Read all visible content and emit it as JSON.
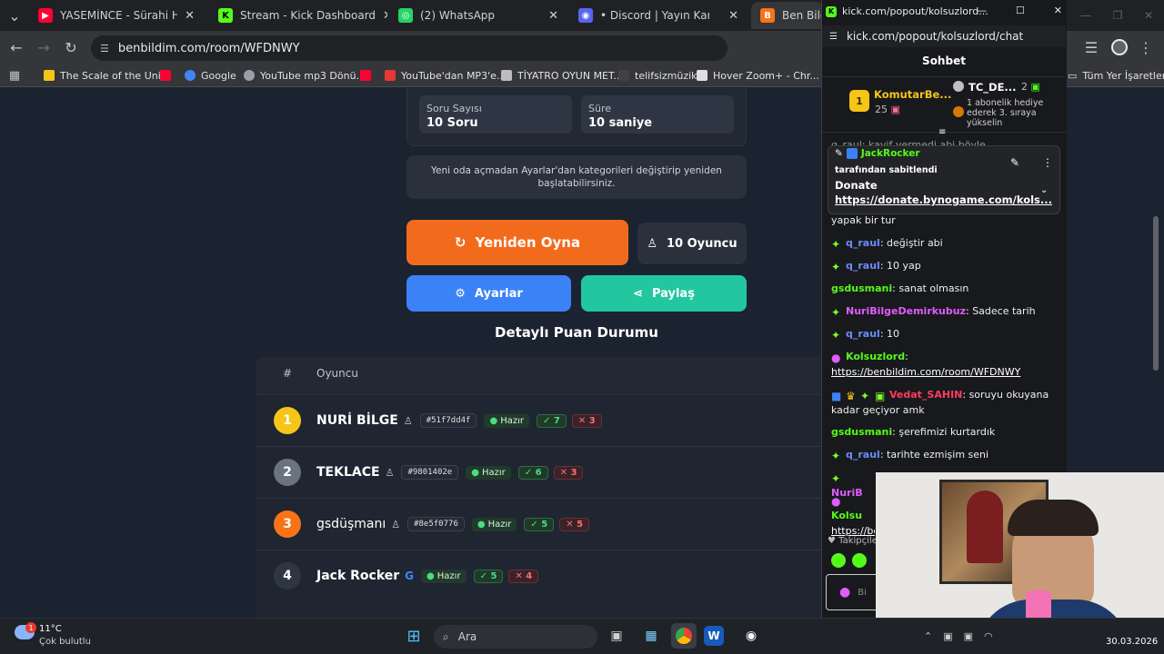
{
  "tabs": [
    {
      "label": "YASEMİNCE - Sürahi Hanım - Te",
      "color": "#ff0033",
      "glyph": "▶"
    },
    {
      "label": "Stream - Kick Dashboard",
      "color": "#53fc18",
      "glyph": "K"
    },
    {
      "label": "(2) WhatsApp",
      "color": "#25d366",
      "glyph": "◎"
    },
    {
      "label": "• Discord | Yayın Kanalı | Ko",
      "color": "#5865f2",
      "glyph": "◉"
    },
    {
      "label": "Ben Bildim",
      "color": "#f97316",
      "glyph": "B"
    }
  ],
  "address": "benbildim.com/room/WFDNWY",
  "bookmarks": [
    {
      "label": "The Scale of the Uni...",
      "color": "#f5c518"
    },
    {
      "label": "",
      "color": "#ff0033"
    },
    {
      "label": "Google",
      "color": "#4285f4"
    },
    {
      "label": "YouTube mp3 Dönü...",
      "color": "#9aa0a6"
    },
    {
      "label": "",
      "color": "#ff0033"
    },
    {
      "label": "YouTube'dan MP3'e...",
      "color": "#e53935"
    },
    {
      "label": "TİYATRO OYUN MET...",
      "color": "#bdbdbd"
    },
    {
      "label": "telifsizmüzik",
      "color": "#424242"
    },
    {
      "label": "Hover Zoom+ - Chr...",
      "color": "#e0e0e0"
    }
  ],
  "bookmarks_right": "Tüm Yer İşaretleri",
  "room": {
    "soru_label": "Soru Sayısı",
    "soru_value": "10 Soru",
    "sure_label": "Süre",
    "sure_value": "10 saniye",
    "notice": "Yeni oda açmadan Ayarlar'dan kategorileri değiştirip yeniden başlatabilirsiniz.",
    "replay": "Yeniden Oyna",
    "players": "10 Oyuncu",
    "settings": "Ayarlar",
    "share": "Paylaş",
    "scoreboard_title": "Detaylı Puan Durumu",
    "col_rank": "#",
    "col_player": "Oyuncu"
  },
  "players": [
    {
      "rank": "1",
      "name": "NURİ BİLGE",
      "id": "#51f7dd4f",
      "status": "Hazır",
      "correct": "7",
      "wrong": "3",
      "color": "#f5c518"
    },
    {
      "rank": "2",
      "name": "TEKLACE",
      "id": "#9801402e",
      "status": "Hazır",
      "correct": "6",
      "wrong": "3",
      "color": "#9aa0a6"
    },
    {
      "rank": "3",
      "name": "gsdüşmanı",
      "id": "#8e5f0776",
      "status": "Hazır",
      "correct": "5",
      "wrong": "5",
      "color": "#f97316"
    },
    {
      "rank": "4",
      "name": "Jack Rocker",
      "id": "",
      "status": "Hazır",
      "correct": "5",
      "wrong": "4",
      "color": "#2f3643"
    }
  ],
  "popup": {
    "url_title": "kick.com/popout/kolsuzlord...",
    "url": "kick.com/popout/kolsuzlord/chat",
    "header": "Sohbet",
    "lb1_name": "KomutarBe...",
    "lb1_count": "25",
    "lb2_name": "TC_DE...",
    "lb2_count": "2",
    "lb_note": "1 abonelik hediye ederek 3. sıraya yükselin",
    "pin_user": "JackRocker",
    "pin_by": "tarafından sabitlendi",
    "pin_title": "Donate",
    "pin_link": "https://donate.bynogame.com/kols...",
    "overflow": "yapak bir tur",
    "follow": "Takipçile",
    "input_placeholder": "Bi"
  },
  "chat": [
    {
      "user": "q_raul",
      "text": "değiştir abi",
      "cls": "ub",
      "badge": "✦"
    },
    {
      "user": "q_raul",
      "text": "10 yap",
      "cls": "ub",
      "badge": "✦"
    },
    {
      "user": "gsdusmani",
      "text": "sanat olmasın",
      "cls": "ug",
      "badge": ""
    },
    {
      "user": "NuriBilgeDemirkubuz",
      "text": "Sadece tarih",
      "cls": "up",
      "badge": "✦"
    },
    {
      "user": "q_raul",
      "text": "10",
      "cls": "ub",
      "badge": "✦"
    },
    {
      "user": "Kolsuzlord",
      "text": "https://benbildim.com/room/WFDNWY",
      "cls": "ug",
      "badge": "🎙"
    },
    {
      "user": "Vedat_SAHIN",
      "text": "soruyu okuyana kadar geçiyor amk",
      "cls": "ur",
      "badge": "★"
    },
    {
      "user": "gsdusmani",
      "text": "şerefimizi kurtardık",
      "cls": "ug",
      "badge": ""
    },
    {
      "user": "q_raul",
      "text": "tarihte ezmişim seni",
      "cls": "ub",
      "badge": "✦"
    },
    {
      "user": "NuriB",
      "text": "",
      "cls": "up",
      "badge": "✦"
    },
    {
      "user": "Kolsu",
      "text": "https://be",
      "cls": "ug",
      "badge": "🎙"
    }
  ],
  "taskbar": {
    "temp": "11°C",
    "weather": "Çok bulutlu",
    "search": "Ara",
    "date": "30.03.2026"
  }
}
